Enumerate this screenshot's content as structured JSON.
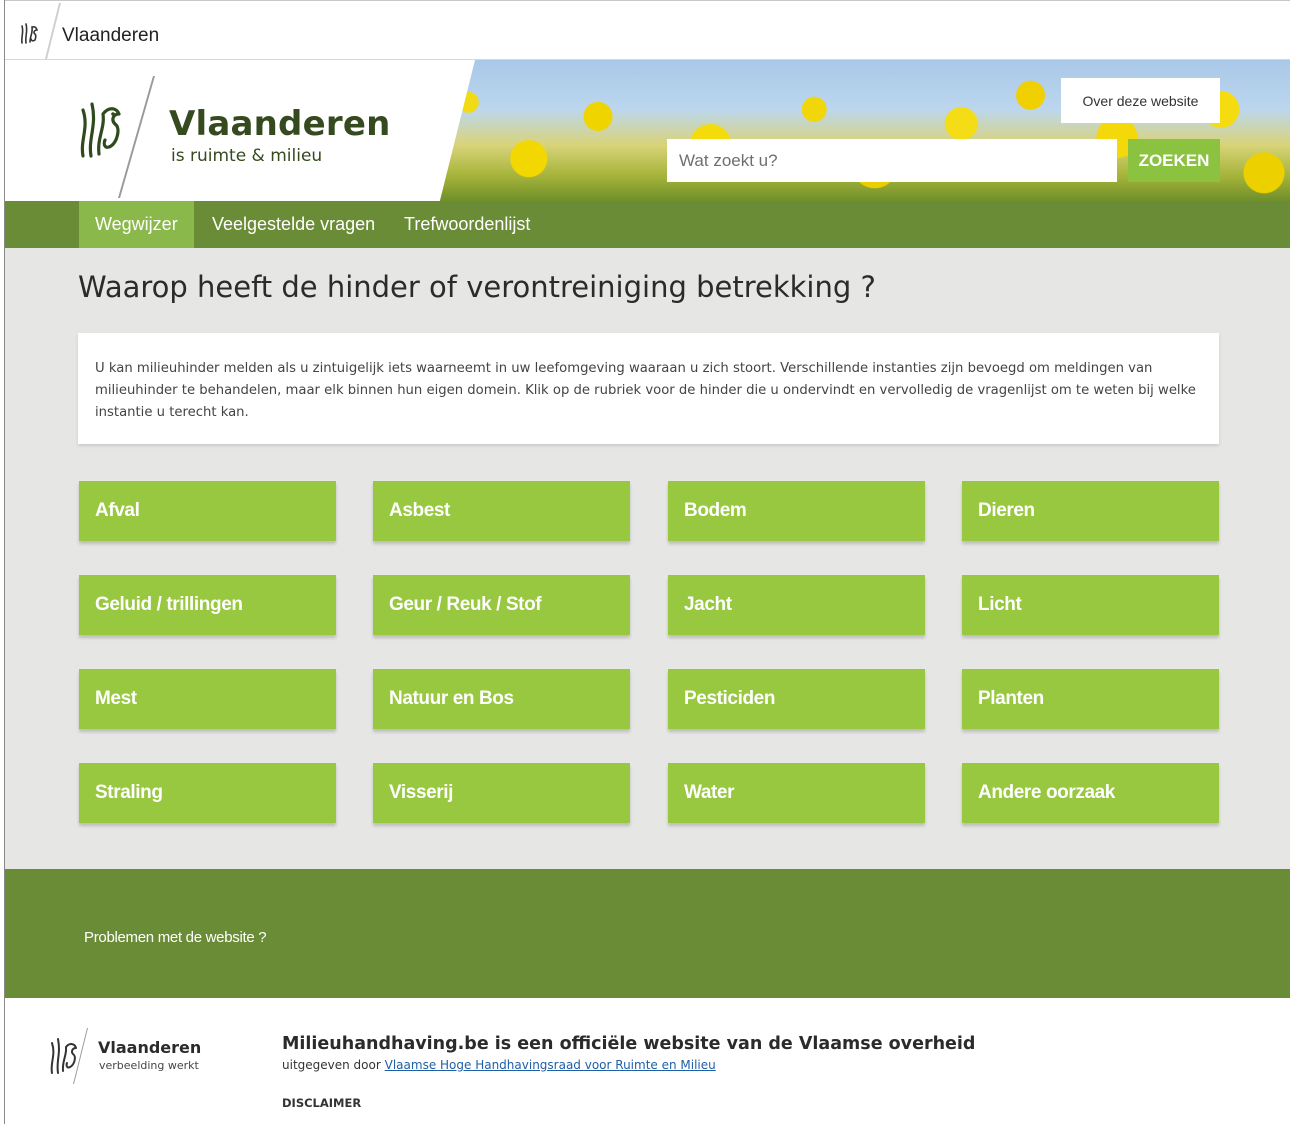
{
  "topbar": {
    "brand": "Vlaanderen"
  },
  "header": {
    "logo_title": "Vlaanderen",
    "logo_subtitle": "is ruimte & milieu",
    "about_label": "Over deze website",
    "search_placeholder": "Wat zoekt u?",
    "search_button": "ZOEKEN"
  },
  "nav": {
    "items": [
      {
        "label": "Wegwijzer",
        "active": true
      },
      {
        "label": "Veelgestelde vragen",
        "active": false
      },
      {
        "label": "Trefwoordenlijst",
        "active": false
      }
    ]
  },
  "main": {
    "title": "Waarop heeft de hinder of verontreiniging betrekking ?",
    "intro": "U kan milieuhinder melden als u zintuigelijk iets waarneemt in uw leefomgeving waaraan u zich stoort. Verschillende instanties zijn bevoegd om meldingen van milieuhinder te behandelen, maar elk binnen hun eigen domein. Klik op de rubriek voor de hinder die u ondervindt en vervolledig de vragenlijst om te weten bij welke instantie u terecht kan.",
    "categories": [
      "Afval",
      "Asbest",
      "Bodem",
      "Dieren",
      "Geluid / trillingen",
      "Geur / Reuk / Stof",
      "Jacht",
      "Licht",
      "Mest",
      "Natuur en Bos",
      "Pesticiden",
      "Planten",
      "Straling",
      "Visserij",
      "Water",
      "Andere oorzaak"
    ]
  },
  "footer": {
    "problems_link": "Problemen met de website ?",
    "brand": "Vlaanderen",
    "brand_sub": "verbeelding werkt",
    "official_title": "Milieuhandhaving.be is een officiële website van de Vlaamse overheid",
    "published_by_prefix": "uitgegeven door",
    "publisher_link": "Vlaamse Hoge Handhavingsraad voor Ruimte en Milieu",
    "disclaimer": "DISCLAIMER"
  },
  "colors": {
    "nav_green": "#6a8c37",
    "tile_green": "#98c83f",
    "active_tab": "#8bb84a",
    "search_button": "#8bc240"
  }
}
